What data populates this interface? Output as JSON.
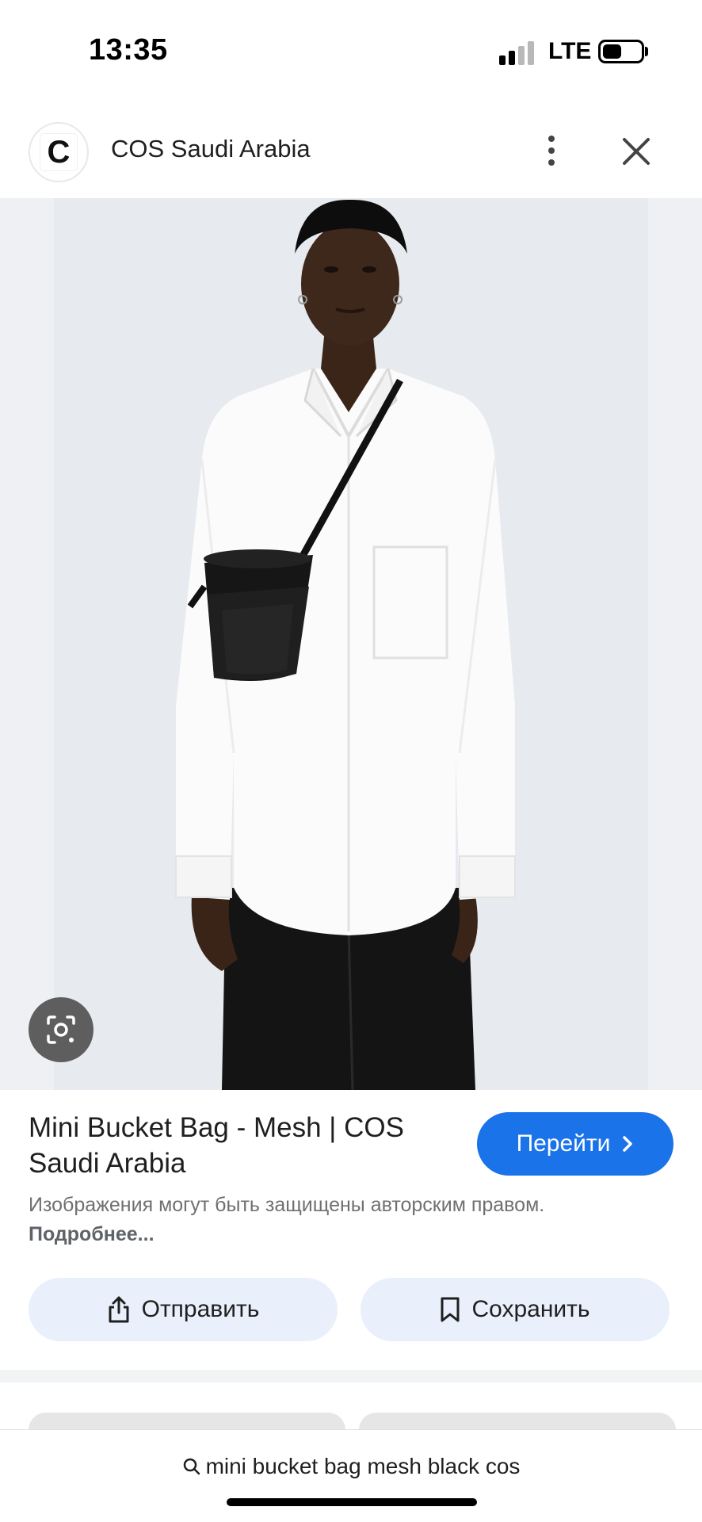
{
  "status_bar": {
    "time": "13:35",
    "network": "LTE",
    "battery_level": 0.5
  },
  "header": {
    "site_logo_letter": "C",
    "site_name": "COS Saudi Arabia",
    "more_icon": "more-vert-icon",
    "close_icon": "close-icon"
  },
  "image": {
    "lens_icon": "lens-search-icon"
  },
  "result": {
    "title": "Mini Bucket Bag - Mesh | COS Saudi Arabia",
    "visit_label": "Перейти",
    "copyright_text": "Изображения могут быть защищены авторским правом.",
    "copyright_link": "Подробнее..."
  },
  "actions": {
    "share_label": "Отправить",
    "save_label": "Сохранить"
  },
  "search": {
    "query": "mini bucket bag mesh black cos"
  },
  "colors": {
    "accent": "#1a73e8",
    "action_bg": "#e9f0fb"
  }
}
